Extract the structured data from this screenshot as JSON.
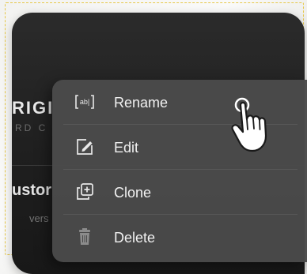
{
  "background_card": {
    "title_partial": "RIGI",
    "subtitle_partial": "RD C",
    "heading_partial": "ustor",
    "subtext_partial": "vers"
  },
  "context_menu": {
    "items": [
      {
        "label": "Rename",
        "icon": "rename-field-icon"
      },
      {
        "label": "Edit",
        "icon": "edit-pencil-icon"
      },
      {
        "label": "Clone",
        "icon": "clone-icon"
      },
      {
        "label": "Delete",
        "icon": "trash-icon"
      }
    ]
  },
  "cursor": {
    "icon": "hand-pointer-icon"
  },
  "colors": {
    "device_bg": "#222222",
    "menu_bg": "#4a4a4a",
    "menu_text": "#f1f1f1",
    "frame_dash": "#e6c84a"
  }
}
